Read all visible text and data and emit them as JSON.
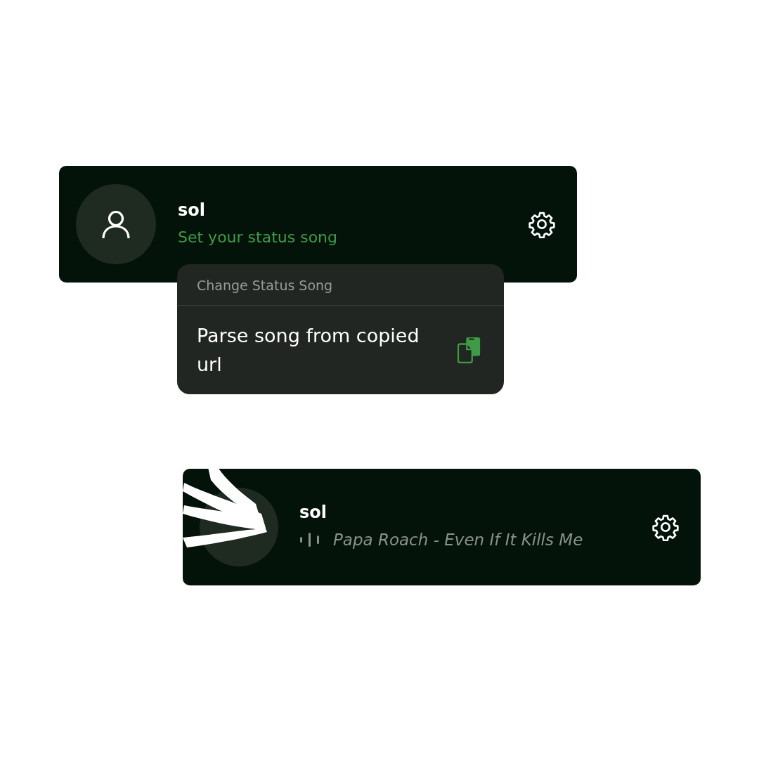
{
  "profile_cards": [
    {
      "username": "sol",
      "avatar": {
        "kind": "person"
      },
      "status": {
        "kind": "prompt",
        "text": "Set your status song"
      },
      "scribbled": false,
      "context_menu": {
        "title": "Change Status Song",
        "items": [
          {
            "label": "Parse song from copied url",
            "kind": "copy"
          }
        ]
      }
    },
    {
      "username": "sol",
      "status": {
        "kind": "playing",
        "text": "Papa Roach - Even If It Kills Me"
      },
      "scribbled": true
    }
  ]
}
